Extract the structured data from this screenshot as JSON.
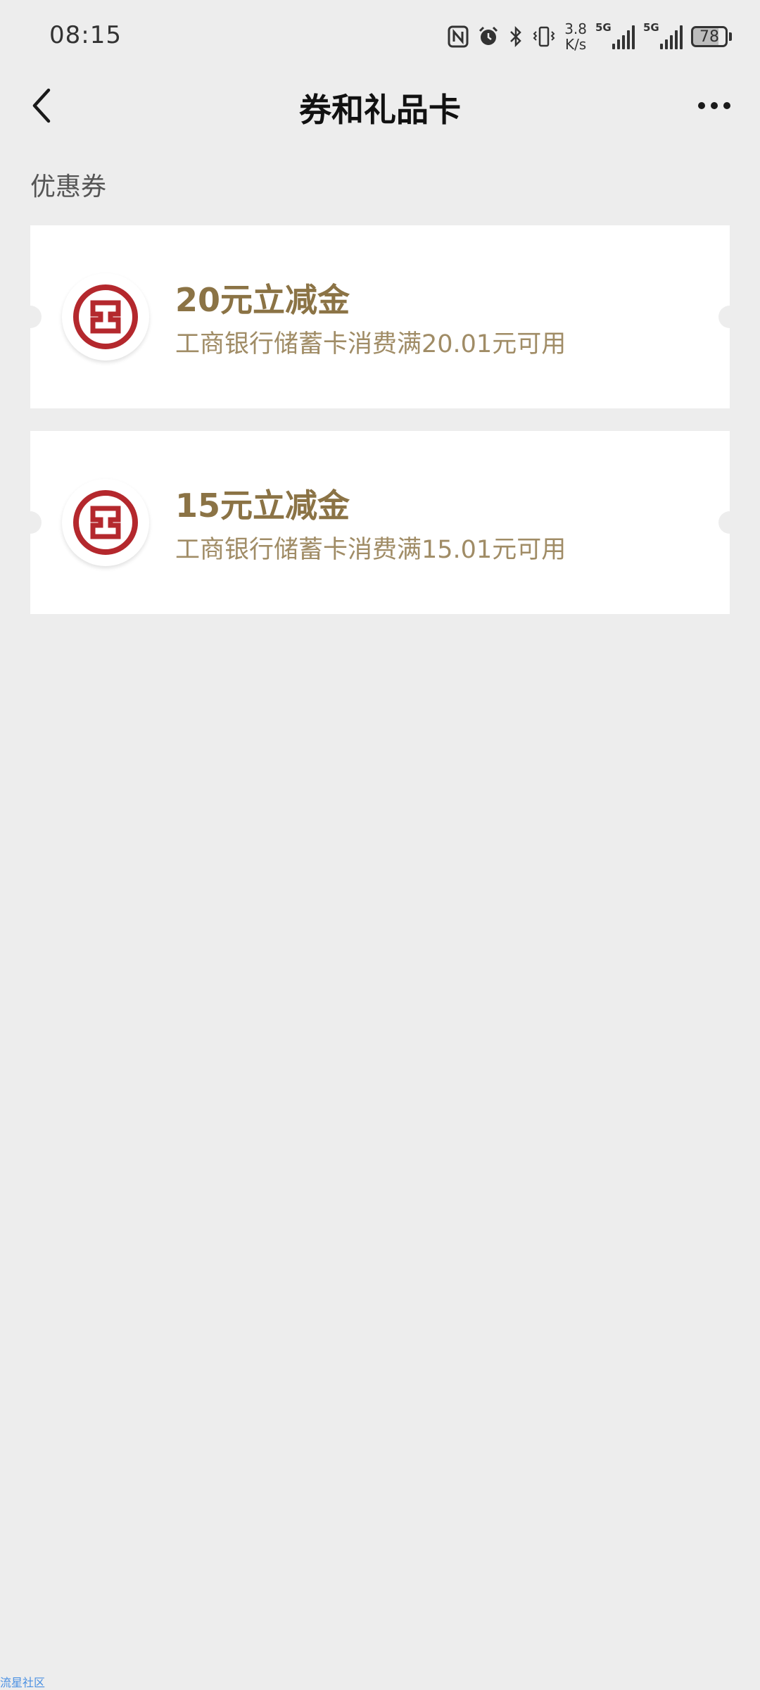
{
  "status_bar": {
    "time": "08:15",
    "speed_value": "3.8",
    "speed_unit": "K/s",
    "signal1_tag": "5G",
    "signal2_tag": "5G",
    "battery": "78"
  },
  "header": {
    "title": "券和礼品卡"
  },
  "section": {
    "title": "优惠券"
  },
  "coupons": [
    {
      "title": "20元立减金",
      "desc": "工商银行储蓄卡消费满20.01元可用"
    },
    {
      "title": "15元立减金",
      "desc": "工商银行储蓄卡消费满15.01元可用"
    }
  ],
  "watermark": "流星社区",
  "colors": {
    "background": "#ededed",
    "card": "#ffffff",
    "coupon_title": "#8b7345",
    "coupon_desc": "#a08c66",
    "bank_red": "#b4282d"
  },
  "icons": {
    "back": "chevron-left-icon",
    "more": "more-dots-icon",
    "bank_logo": "icbc-logo-icon"
  }
}
